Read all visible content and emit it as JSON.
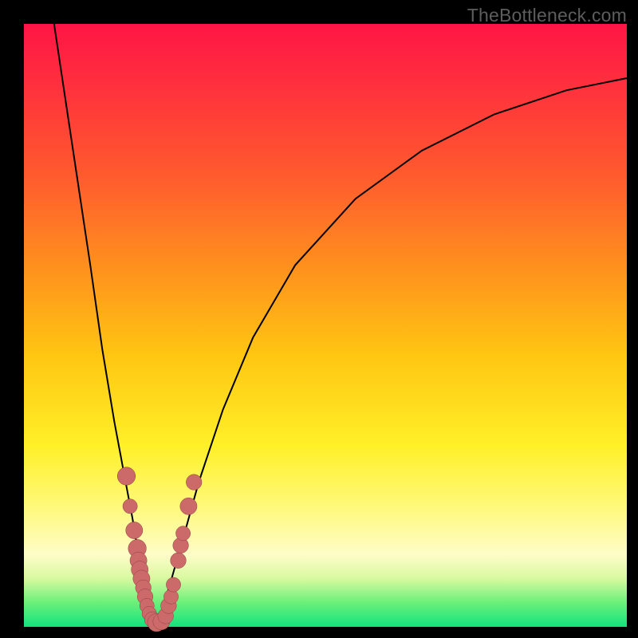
{
  "attribution": "TheBottleneck.com",
  "colors": {
    "curve": "#000000",
    "marker_fill": "#cc6a6a",
    "marker_stroke": "#8e3e3e",
    "background_black": "#000000"
  },
  "chart_data": {
    "type": "line",
    "title": "",
    "xlabel": "",
    "ylabel": "",
    "xlim": [
      0,
      100
    ],
    "ylim": [
      0,
      100
    ],
    "series": [
      {
        "name": "left-branch",
        "x": [
          5,
          8,
          11,
          13,
          15,
          16.5,
          18,
          19,
          19.7,
          20.3,
          21,
          22
        ],
        "y": [
          100,
          80,
          60,
          46,
          34,
          26,
          18,
          12,
          8,
          5,
          2.5,
          1
        ]
      },
      {
        "name": "right-branch",
        "x": [
          22,
          23,
          24.5,
          26.5,
          29,
          33,
          38,
          45,
          55,
          66,
          78,
          90,
          100
        ],
        "y": [
          1,
          3,
          8,
          15,
          24,
          36,
          48,
          60,
          71,
          79,
          85,
          89,
          91
        ]
      }
    ],
    "markers": [
      {
        "x": 17.0,
        "y": 25.0,
        "r": 1.5
      },
      {
        "x": 17.6,
        "y": 20.0,
        "r": 1.2
      },
      {
        "x": 18.3,
        "y": 16.0,
        "r": 1.4
      },
      {
        "x": 18.8,
        "y": 13.0,
        "r": 1.5
      },
      {
        "x": 19.0,
        "y": 11.0,
        "r": 1.4
      },
      {
        "x": 19.2,
        "y": 9.5,
        "r": 1.4
      },
      {
        "x": 19.5,
        "y": 8.0,
        "r": 1.4
      },
      {
        "x": 19.8,
        "y": 6.5,
        "r": 1.3
      },
      {
        "x": 20.1,
        "y": 5.0,
        "r": 1.3
      },
      {
        "x": 20.4,
        "y": 3.5,
        "r": 1.2
      },
      {
        "x": 20.8,
        "y": 2.2,
        "r": 1.2
      },
      {
        "x": 21.3,
        "y": 1.2,
        "r": 1.3
      },
      {
        "x": 22.0,
        "y": 0.7,
        "r": 1.5
      },
      {
        "x": 22.8,
        "y": 0.9,
        "r": 1.4
      },
      {
        "x": 23.5,
        "y": 1.8,
        "r": 1.3
      },
      {
        "x": 24.0,
        "y": 3.5,
        "r": 1.3
      },
      {
        "x": 24.4,
        "y": 5.0,
        "r": 1.2
      },
      {
        "x": 24.8,
        "y": 7.0,
        "r": 1.2
      },
      {
        "x": 25.6,
        "y": 11.0,
        "r": 1.3
      },
      {
        "x": 26.0,
        "y": 13.5,
        "r": 1.3
      },
      {
        "x": 26.4,
        "y": 15.5,
        "r": 1.2
      },
      {
        "x": 27.3,
        "y": 20.0,
        "r": 1.4
      },
      {
        "x": 28.2,
        "y": 24.0,
        "r": 1.3
      }
    ]
  }
}
